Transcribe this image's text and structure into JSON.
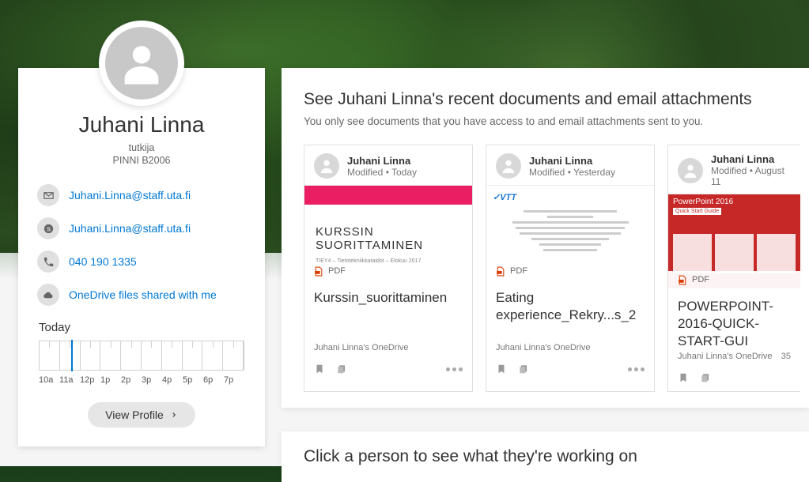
{
  "profile": {
    "name": "Juhani Linna",
    "job_title": "tutkija",
    "location": "PINNI B2006",
    "contacts": {
      "email": "Juhani.Linna@staff.uta.fi",
      "skype": "Juhani.Linna@staff.uta.fi",
      "phone": "040 190 1335",
      "onedrive": "OneDrive files shared with me"
    },
    "calendar": {
      "today_label": "Today",
      "hours": [
        "10a",
        "11a",
        "12p",
        "1p",
        "2p",
        "3p",
        "4p",
        "5p",
        "6p",
        "7p"
      ]
    },
    "view_profile_label": "View Profile"
  },
  "content": {
    "heading": "See Juhani Linna's recent documents and email attachments",
    "subheading": "You only see documents that you have access to and email attachments sent to you.",
    "documents": [
      {
        "author": "Juhani Linna",
        "modified": "Modified • Today",
        "file_type": "PDF",
        "title": "Kurssin_suorittaminen",
        "location": "Juhani Linna's OneDrive",
        "views": "",
        "preview_sub": "TIEY4 – Tietotekniikkataidot – Elokuu 2017"
      },
      {
        "author": "Juhani Linna",
        "modified": "Modified • Yesterday",
        "file_type": "PDF",
        "title": "Eating experience_Rekry...s_2",
        "location": "Juhani Linna's OneDrive",
        "views": ""
      },
      {
        "author": "Juhani Linna",
        "modified": "Modified • August 11",
        "file_type": "PDF",
        "title": "POWERPOINT-2016-QUICK-START-GUI",
        "location": "Juhani Linna's OneDrive",
        "views": "35",
        "preview_top": "PowerPoint 2016",
        "preview_qsg": "Quick Start Guide"
      }
    ]
  },
  "secondary": {
    "heading": "Click a person to see what they're working on"
  }
}
